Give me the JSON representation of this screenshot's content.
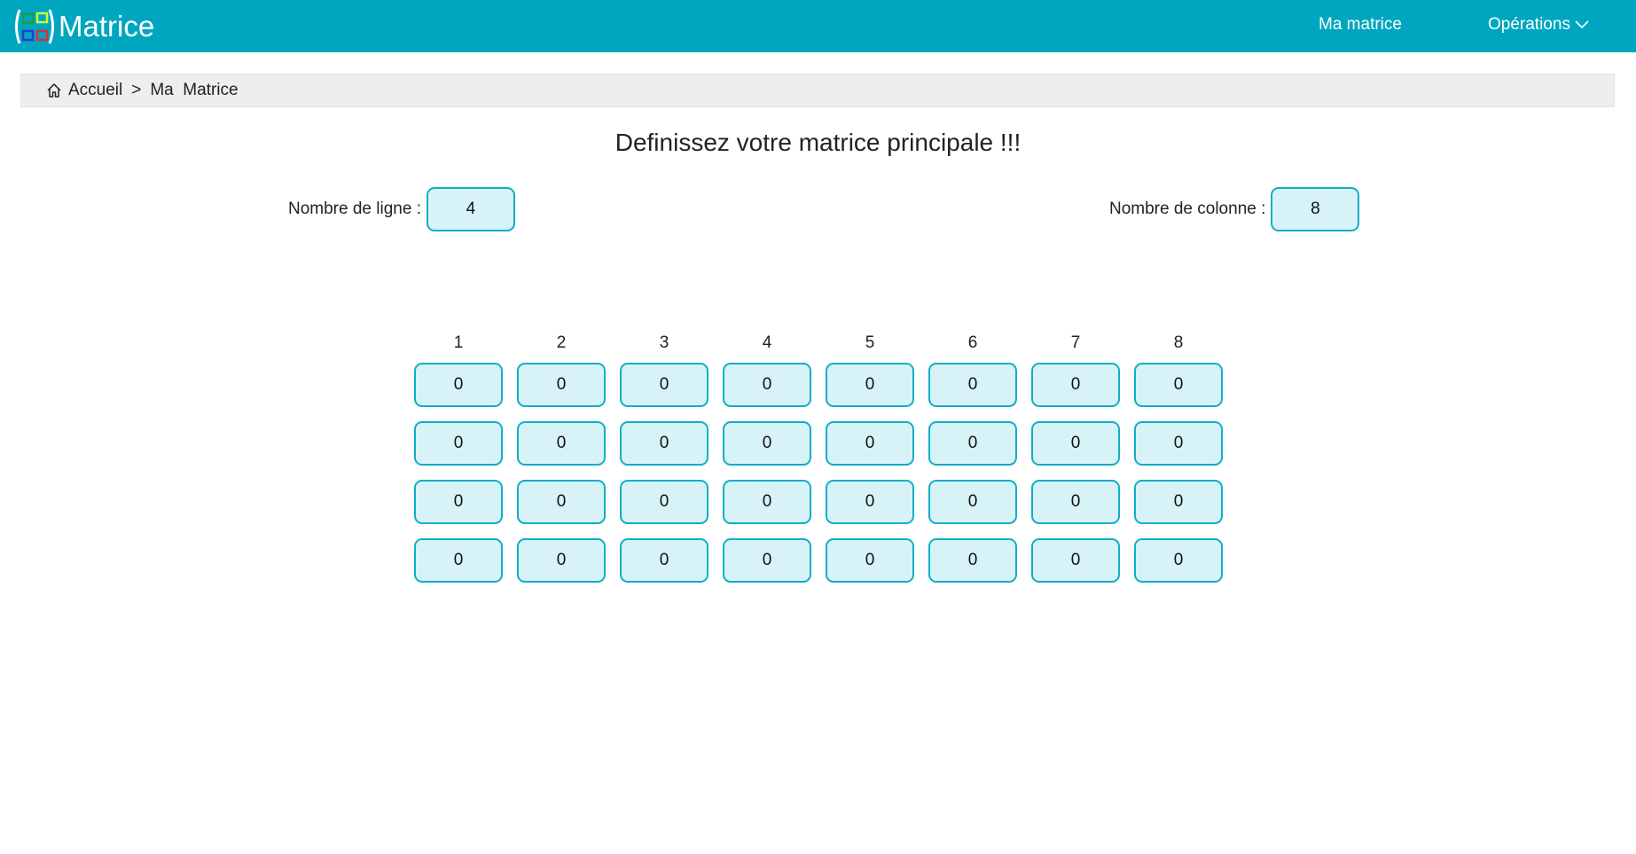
{
  "navbar": {
    "brand": "Matrice",
    "links": {
      "my_matrix": "Ma matrice",
      "operations": "Opérations"
    },
    "colors": {
      "background": "#00a6bf",
      "text": "#ffffff"
    },
    "logo_icon": "matrix-logo-icon"
  },
  "breadcrumb": {
    "home_icon": "home-icon",
    "home": "Accueil",
    "separator": ">",
    "current": "Ma  Matrice"
  },
  "main": {
    "title": "Definissez votre matrice principale !!!",
    "rows_label": "Nombre de ligne :",
    "rows_value": "4",
    "cols_label": "Nombre de colonne :",
    "cols_value": "8"
  },
  "matrix": {
    "column_headers": [
      "1",
      "2",
      "3",
      "4",
      "5",
      "6",
      "7",
      "8"
    ],
    "values": [
      [
        "0",
        "0",
        "0",
        "0",
        "0",
        "0",
        "0",
        "0"
      ],
      [
        "0",
        "0",
        "0",
        "0",
        "0",
        "0",
        "0",
        "0"
      ],
      [
        "0",
        "0",
        "0",
        "0",
        "0",
        "0",
        "0",
        "0"
      ],
      [
        "0",
        "0",
        "0",
        "0",
        "0",
        "0",
        "0",
        "0"
      ]
    ],
    "cell_colors": {
      "border": "#11aec6",
      "fill": "#d7f3f7"
    }
  }
}
